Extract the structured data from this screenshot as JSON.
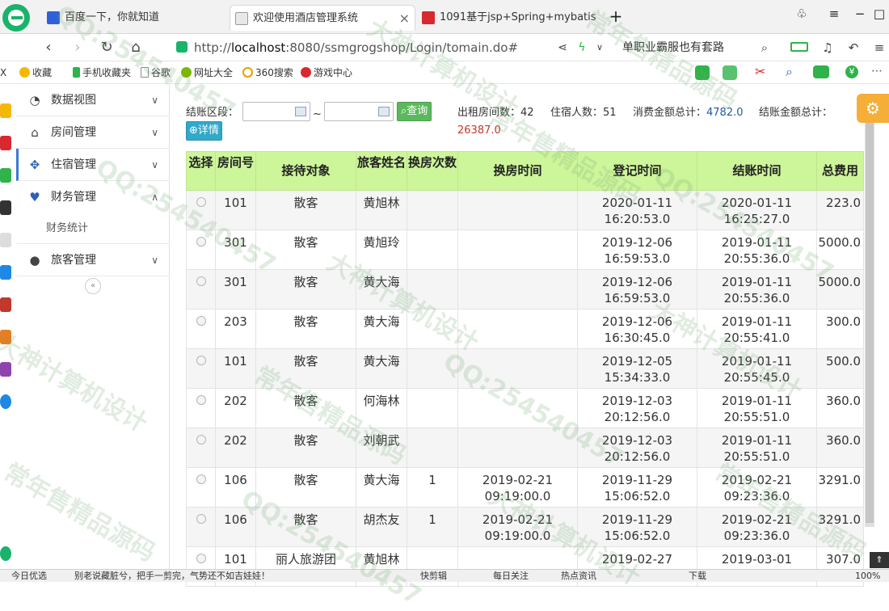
{
  "browser": {
    "tabs": [
      {
        "title": "百度一下，你就知道",
        "active": false
      },
      {
        "title": "欢迎使用酒店管理系统",
        "active": true
      },
      {
        "title": "1091基于jsp+Spring+mybatis",
        "active": false
      }
    ],
    "url_prefix": "http://",
    "url_host": "localhost",
    "url_rest": ":8080/ssmgrogshop/Login/tomain.do#",
    "search_text": "单职业霸服也有套路",
    "bookmarks": [
      "收藏",
      "手机收藏夹",
      "谷歌",
      "网址大全",
      "360搜索",
      "游戏中心"
    ],
    "left_cut_label": "X"
  },
  "sidebar": {
    "items": [
      {
        "label": "数据视图",
        "icon": "dashboard-icon"
      },
      {
        "label": "房间管理",
        "icon": "home-icon"
      },
      {
        "label": "住宿管理",
        "icon": "move-arrows-icon"
      },
      {
        "label": "财务管理",
        "icon": "heart-icon"
      },
      {
        "label": "旅客管理",
        "icon": "user-icon"
      }
    ],
    "submenu": "财务统计",
    "collapse_label": "«"
  },
  "filter": {
    "range_label": "结账区段：",
    "separator": "~",
    "query_button": "查询",
    "detail_button": "详情"
  },
  "stats": {
    "rooms_label": "出租房间数：",
    "rooms_value": "42",
    "guests_label": "住宿人数：",
    "guests_value": "51",
    "spend_label": "消费金额总计：",
    "spend_value": "4782.0",
    "checkout_label": "结账金额总计：",
    "checkout_value": "26387.0"
  },
  "table": {
    "headers": [
      "选择",
      "房间号",
      "接待对象",
      "旅客姓名",
      "换房次数",
      "换房时间",
      "登记时间",
      "结账时间",
      "总费用"
    ],
    "rows": [
      {
        "room": "101",
        "target": "散客",
        "name": "黄旭林",
        "changes": "",
        "change_time": [
          "",
          ""
        ],
        "reg_time": [
          "2020-01-11",
          "16:20:53.0"
        ],
        "out_time": [
          "2020-01-11",
          "16:25:27.0"
        ],
        "total": "223.0"
      },
      {
        "room": "301",
        "target": "散客",
        "name": "黄旭玲",
        "changes": "",
        "change_time": [
          "",
          ""
        ],
        "reg_time": [
          "2019-12-06",
          "16:59:53.0"
        ],
        "out_time": [
          "2019-01-11",
          "20:55:36.0"
        ],
        "total": "5000.0"
      },
      {
        "room": "301",
        "target": "散客",
        "name": "黄大海",
        "changes": "",
        "change_time": [
          "",
          ""
        ],
        "reg_time": [
          "2019-12-06",
          "16:59:53.0"
        ],
        "out_time": [
          "2019-01-11",
          "20:55:36.0"
        ],
        "total": "5000.0"
      },
      {
        "room": "203",
        "target": "散客",
        "name": "黄大海",
        "changes": "",
        "change_time": [
          "",
          ""
        ],
        "reg_time": [
          "2019-12-06",
          "16:30:45.0"
        ],
        "out_time": [
          "2019-01-11",
          "20:55:41.0"
        ],
        "total": "300.0"
      },
      {
        "room": "101",
        "target": "散客",
        "name": "黄大海",
        "changes": "",
        "change_time": [
          "",
          ""
        ],
        "reg_time": [
          "2019-12-05",
          "15:34:33.0"
        ],
        "out_time": [
          "2019-01-11",
          "20:55:45.0"
        ],
        "total": "500.0"
      },
      {
        "room": "202",
        "target": "散客",
        "name": "何海林",
        "changes": "",
        "change_time": [
          "",
          ""
        ],
        "reg_time": [
          "2019-12-03",
          "20:12:56.0"
        ],
        "out_time": [
          "2019-01-11",
          "20:55:51.0"
        ],
        "total": "360.0"
      },
      {
        "room": "202",
        "target": "散客",
        "name": "刘朝武",
        "changes": "",
        "change_time": [
          "",
          ""
        ],
        "reg_time": [
          "2019-12-03",
          "20:12:56.0"
        ],
        "out_time": [
          "2019-01-11",
          "20:55:51.0"
        ],
        "total": "360.0"
      },
      {
        "room": "106",
        "target": "散客",
        "name": "黄大海",
        "changes": "1",
        "change_time": [
          "2019-02-21",
          "09:19:00.0"
        ],
        "reg_time": [
          "2019-11-29",
          "15:06:52.0"
        ],
        "out_time": [
          "2019-02-21",
          "09:23:36.0"
        ],
        "total": "3291.0"
      },
      {
        "room": "106",
        "target": "散客",
        "name": "胡杰友",
        "changes": "1",
        "change_time": [
          "2019-02-21",
          "09:19:00.0"
        ],
        "reg_time": [
          "2019-11-29",
          "15:06:52.0"
        ],
        "out_time": [
          "2019-02-21",
          "09:23:36.0"
        ],
        "total": "3291.0"
      },
      {
        "room": "101",
        "target": "丽人旅游团",
        "name": "黄旭林",
        "changes": "",
        "change_time": [
          "",
          ""
        ],
        "reg_time": [
          "2019-02-27",
          ""
        ],
        "out_time": [
          "2019-03-01",
          ""
        ],
        "total": "307.0"
      }
    ]
  },
  "statusbar": {
    "left": "今日优选",
    "news": "别老说藏脏兮，把手一剪完，气势还不如吉娃娃！",
    "items": [
      "快剪辑",
      "每日关注",
      "热点资讯",
      "下载"
    ],
    "zoom": "100%"
  },
  "watermarks": [
    "QQ:254540457",
    "大神计算机设计",
    "常年售精品源码"
  ],
  "colors": {
    "header_bg": "#cdf59a",
    "accent_blue": "#3a7bd5",
    "query_green": "#5cb85c",
    "detail_teal": "#31a9c9",
    "value_blue": "#1f5aa8",
    "value_red": "#c0392b"
  }
}
